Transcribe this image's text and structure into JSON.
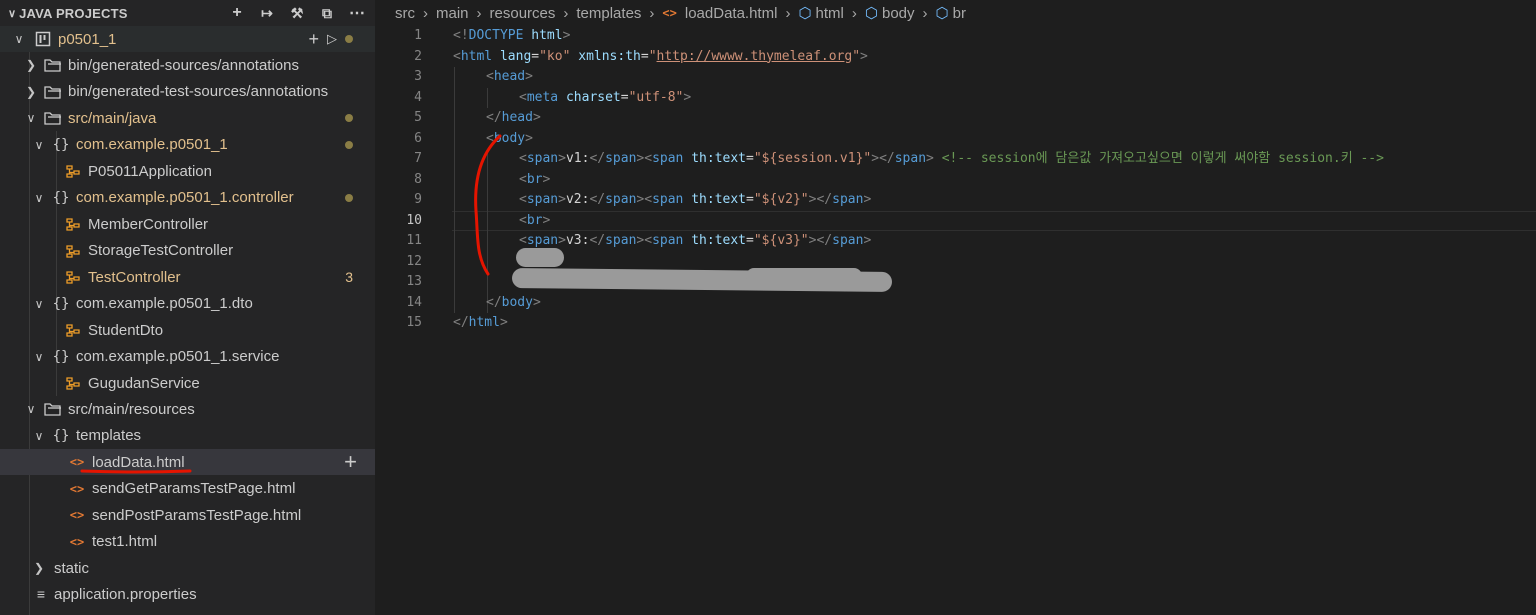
{
  "sidebar": {
    "title": "JAVA PROJECTS",
    "actions": [
      "add-icon",
      "link-icon",
      "tools-icon",
      "collapse-icon",
      "more-icon"
    ],
    "project": {
      "label": "p0501_1"
    },
    "items": [
      {
        "label": "bin/generated-sources/annotations",
        "icon": "folder-icon"
      },
      {
        "label": "bin/generated-test-sources/annotations",
        "icon": "folder-icon"
      },
      {
        "label": "src/main/java",
        "icon": "folder-icon"
      },
      {
        "label": "com.example.p0501_1",
        "icon": "package-icon"
      },
      {
        "label": "P05011Application",
        "icon": "class-icon"
      },
      {
        "label": "com.example.p0501_1.controller",
        "icon": "package-icon"
      },
      {
        "label": "MemberController",
        "icon": "class-icon"
      },
      {
        "label": "StorageTestController",
        "icon": "class-icon"
      },
      {
        "label": "TestController",
        "icon": "class-icon",
        "badge": "3"
      },
      {
        "label": "com.example.p0501_1.dto",
        "icon": "package-icon"
      },
      {
        "label": "StudentDto",
        "icon": "class-icon"
      },
      {
        "label": "com.example.p0501_1.service",
        "icon": "package-icon"
      },
      {
        "label": "GugudanService",
        "icon": "class-icon"
      },
      {
        "label": "src/main/resources",
        "icon": "folder-icon"
      },
      {
        "label": "templates",
        "icon": "package-icon"
      },
      {
        "label": "loadData.html",
        "icon": "html-icon"
      },
      {
        "label": "sendGetParamsTestPage.html",
        "icon": "html-icon"
      },
      {
        "label": "sendPostParamsTestPage.html",
        "icon": "html-icon"
      },
      {
        "label": "test1.html",
        "icon": "html-icon"
      },
      {
        "label": "static",
        "icon": "none"
      },
      {
        "label": "application.properties",
        "icon": "lines-icon"
      }
    ]
  },
  "breadcrumb": [
    "src",
    "main",
    "resources",
    "templates",
    "loadData.html",
    "html",
    "body",
    "br"
  ],
  "editor": {
    "current_line": 10,
    "line_numbers": [
      "1",
      "2",
      "3",
      "4",
      "5",
      "6",
      "7",
      "8",
      "9",
      "10",
      "11",
      "12",
      "13",
      "14",
      "15"
    ],
    "code": {
      "l1": {
        "a": "<!",
        "b": "DOCTYPE",
        "c": " html",
        "d": ">"
      },
      "l2": {
        "a": "<",
        "b": "html",
        "c": " lang",
        "d": "=",
        "e": "\"ko\"",
        "f": " xmlns:th",
        "g": "=",
        "h": "\"",
        "i": "http://wwww.thymeleaf.org",
        "j": "\"",
        "k": ">"
      },
      "l3": {
        "a": "<",
        "b": "head",
        "c": ">"
      },
      "l4": {
        "a": "<",
        "b": "meta",
        "c": " charset",
        "d": "=",
        "e": "\"utf-8\"",
        "f": ">"
      },
      "l5": {
        "a": "</",
        "b": "head",
        "c": ">"
      },
      "l6": {
        "a": "<",
        "b": "body",
        "c": ">"
      },
      "l7": {
        "a": "<",
        "b": "span",
        "c": ">",
        "d": "v1:",
        "e": "</",
        "f": "span",
        "g": "><",
        "h": "span",
        "i": " th:text",
        "j": "=",
        "k": "\"${session.v1}\"",
        "l": "></",
        "m": "span",
        "n": ">",
        "o": " <!-- session에 담은값 가져오고싶으면 이렇게 써야함 session.키 -->"
      },
      "l8": {
        "a": "<",
        "b": "br",
        "c": ">"
      },
      "l9": {
        "a": "<",
        "b": "span",
        "c": ">",
        "d": "v2:",
        "e": "</",
        "f": "span",
        "g": "><",
        "h": "span",
        "i": " th:text",
        "j": "=",
        "k": "\"${v2}\"",
        "l": "></",
        "m": "span",
        "n": ">"
      },
      "l10": {
        "a": "<",
        "b": "br",
        "c": ">"
      },
      "l11": {
        "a": "<",
        "b": "span",
        "c": ">",
        "d": "v3:",
        "e": "</",
        "f": "span",
        "g": "><",
        "h": "span",
        "i": " th:text",
        "j": "=",
        "k": "\"${v3}\"",
        "l": "></",
        "m": "span",
        "n": ">"
      },
      "l14": {
        "a": "</",
        "b": "body",
        "c": ">"
      },
      "l15": {
        "a": "</",
        "b": "html",
        "c": ">"
      }
    }
  },
  "colors": {
    "tag": "#569cd6",
    "attr": "#9cdcfe",
    "string": "#ce9178",
    "comment": "#6a9955",
    "modified": "#e2c08d",
    "annotation": "#e51400"
  }
}
